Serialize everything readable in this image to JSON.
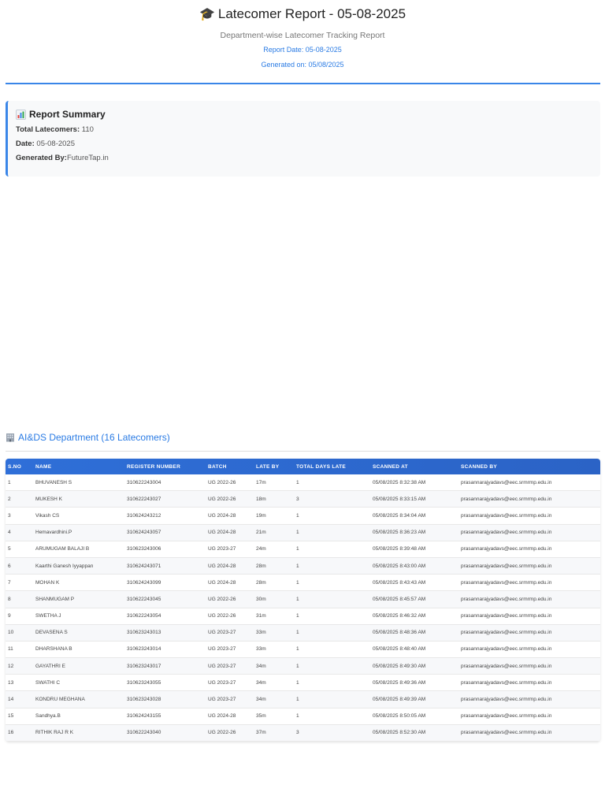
{
  "header": {
    "title_icon": "graduation-cap-icon",
    "title": "Latecomer Report - 05-08-2025",
    "subtitle": "Department-wise Latecomer Tracking Report",
    "report_date": "Report Date: 05-08-2025",
    "generated_on": "Generated on: 05/08/2025",
    "accent_color": "#3a86e8"
  },
  "summary": {
    "icon": "bar-chart-icon",
    "title": "Report Summary",
    "total_label": "Total Latecomers:",
    "total_value": "110",
    "date_label": "Date:",
    "date_value": "05-08-2025",
    "generated_by_label": "Generated By:",
    "generated_by_value": "FutureTap.in"
  },
  "department": {
    "icon": "building-icon",
    "title": "AI&DS Department (16 Latecomers)",
    "columns": [
      "S.NO",
      "NAME",
      "REGISTER NUMBER",
      "BATCH",
      "LATE BY",
      "TOTAL DAYS LATE",
      "SCANNED AT",
      "SCANNED BY"
    ],
    "rows": [
      [
        "1",
        "BHUVANESH S",
        "310622243004",
        "UG 2022-26",
        "17m",
        "1",
        "05/08/2025 8:32:38 AM",
        "prasannarajyadavs@eec.srmrmp.edu.in"
      ],
      [
        "2",
        "MUKESH K",
        "310622243027",
        "UG 2022-26",
        "18m",
        "3",
        "05/08/2025 8:33:15 AM",
        "prasannarajyadavs@eec.srmrmp.edu.in"
      ],
      [
        "3",
        "Vikash CS",
        "310624243212",
        "UG 2024-28",
        "19m",
        "1",
        "05/08/2025 8:34:04 AM",
        "prasannarajyadavs@eec.srmrmp.edu.in"
      ],
      [
        "4",
        "Hemavardhini.P",
        "310624243057",
        "UG 2024-28",
        "21m",
        "1",
        "05/08/2025 8:36:23 AM",
        "prasannarajyadavs@eec.srmrmp.edu.in"
      ],
      [
        "5",
        "ARUMUGAM BALAJI B",
        "310623243006",
        "UG 2023-27",
        "24m",
        "1",
        "05/08/2025 8:39:48 AM",
        "prasannarajyadavs@eec.srmrmp.edu.in"
      ],
      [
        "6",
        "Kaarthi Ganesh Iyyappan",
        "310624243071",
        "UG 2024-28",
        "28m",
        "1",
        "05/08/2025 8:43:00 AM",
        "prasannarajyadavs@eec.srmrmp.edu.in"
      ],
      [
        "7",
        "MOHAN K",
        "310624243099",
        "UG 2024-28",
        "28m",
        "1",
        "05/08/2025 8:43:43 AM",
        "prasannarajyadavs@eec.srmrmp.edu.in"
      ],
      [
        "8",
        "SHANMUGAM P",
        "310622243045",
        "UG 2022-26",
        "30m",
        "1",
        "05/08/2025 8:45:57 AM",
        "prasannarajyadavs@eec.srmrmp.edu.in"
      ],
      [
        "9",
        "SWETHA J",
        "310622243054",
        "UG 2022-26",
        "31m",
        "1",
        "05/08/2025 8:46:32 AM",
        "prasannarajyadavs@eec.srmrmp.edu.in"
      ],
      [
        "10",
        "DEVASENA S",
        "310623243013",
        "UG 2023-27",
        "33m",
        "1",
        "05/08/2025 8:48:36 AM",
        "prasannarajyadavs@eec.srmrmp.edu.in"
      ],
      [
        "11",
        "DHARSHANA B",
        "310623243014",
        "UG 2023-27",
        "33m",
        "1",
        "05/08/2025 8:48:40 AM",
        "prasannarajyadavs@eec.srmrmp.edu.in"
      ],
      [
        "12",
        "GAYATHRI E",
        "310623243017",
        "UG 2023-27",
        "34m",
        "1",
        "05/08/2025 8:49:30 AM",
        "prasannarajyadavs@eec.srmrmp.edu.in"
      ],
      [
        "13",
        "SWATHI C",
        "310623243055",
        "UG 2023-27",
        "34m",
        "1",
        "05/08/2025 8:49:36 AM",
        "prasannarajyadavs@eec.srmrmp.edu.in"
      ],
      [
        "14",
        "KONDRU MEGHANA",
        "310623243028",
        "UG 2023-27",
        "34m",
        "1",
        "05/08/2025 8:49:39 AM",
        "prasannarajyadavs@eec.srmrmp.edu.in"
      ],
      [
        "15",
        "Sandhya.B",
        "310624243155",
        "UG 2024-28",
        "35m",
        "1",
        "05/08/2025 8:50:05 AM",
        "prasannarajyadavs@eec.srmrmp.edu.in"
      ],
      [
        "16",
        "RITHIK RAJ R K",
        "310622243040",
        "UG 2022-26",
        "37m",
        "3",
        "05/08/2025 8:52:30 AM",
        "prasannarajyadavs@eec.srmrmp.edu.in"
      ]
    ]
  }
}
